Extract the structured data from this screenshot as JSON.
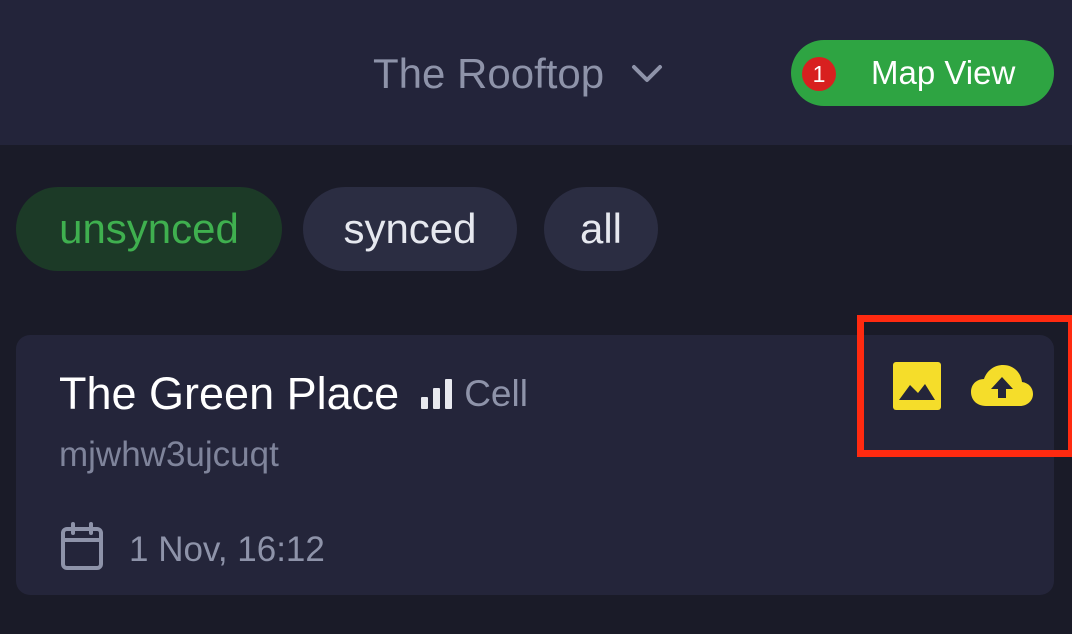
{
  "header": {
    "location_name": "The Rooftop",
    "map_view_label": "Map View",
    "map_view_badge": "1"
  },
  "filters": [
    {
      "label": "unsynced",
      "active": true
    },
    {
      "label": "synced",
      "active": false
    },
    {
      "label": "all",
      "active": false
    }
  ],
  "items": [
    {
      "title": "The Green Place",
      "signal_type": "Cell",
      "geohash": "mjwhw3ujcuqt",
      "date": "1 Nov, 16:12"
    }
  ],
  "icons": {
    "chevron": "chevron-down-icon",
    "signal": "signal-bars-icon",
    "calendar": "calendar-icon",
    "image": "image-icon",
    "upload": "cloud-upload-icon"
  },
  "colors": {
    "accent_green": "#2ea442",
    "active_chip_text": "#3fb04f",
    "badge_red": "#d8201f",
    "icon_yellow": "#f5dd2a",
    "highlight_red": "#ff2a10"
  }
}
